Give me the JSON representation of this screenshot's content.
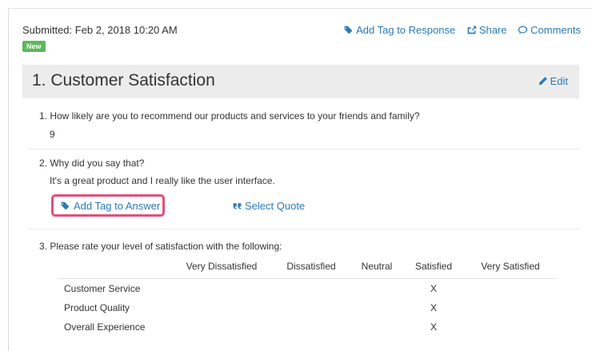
{
  "response": {
    "submitted": "Submitted: Feb 2, 2018 10:20 AM",
    "badge": "New"
  },
  "toolbar": {
    "add_tag_response": "Add Tag to Response",
    "share": "Share",
    "comments": "Comments"
  },
  "section": {
    "title": "1. Customer Satisfaction",
    "edit": "Edit"
  },
  "questions": [
    {
      "text": "1. How likely are you to recommend our products and services to your friends and family?",
      "answer": "9"
    },
    {
      "text": "2. Why did you say that?",
      "answer": "It's a great product and I really like the user interface."
    },
    {
      "text": "3. Please rate your level of satisfaction with the following:"
    }
  ],
  "answer_actions": {
    "add_tag_answer": "Add Tag to Answer",
    "select_quote": "Select Quote"
  },
  "grid": {
    "columns": [
      "Very Dissatisfied",
      "Dissatisfied",
      "Neutral",
      "Satisfied",
      "Very Satisfied"
    ],
    "rows": [
      {
        "label": "Customer Service",
        "cells": [
          "",
          "",
          "",
          "X",
          ""
        ]
      },
      {
        "label": "Product Quality",
        "cells": [
          "",
          "",
          "",
          "X",
          ""
        ]
      },
      {
        "label": "Overall Experience",
        "cells": [
          "",
          "",
          "",
          "X",
          ""
        ]
      }
    ]
  },
  "colors": {
    "link": "#2a7ab8",
    "badge": "#5cb85c",
    "highlight": "#e0507a",
    "header_bg": "#ececec"
  },
  "icons": [
    "tags-icon",
    "share-icon",
    "comment-icon",
    "pencil-icon",
    "quote-icon"
  ]
}
